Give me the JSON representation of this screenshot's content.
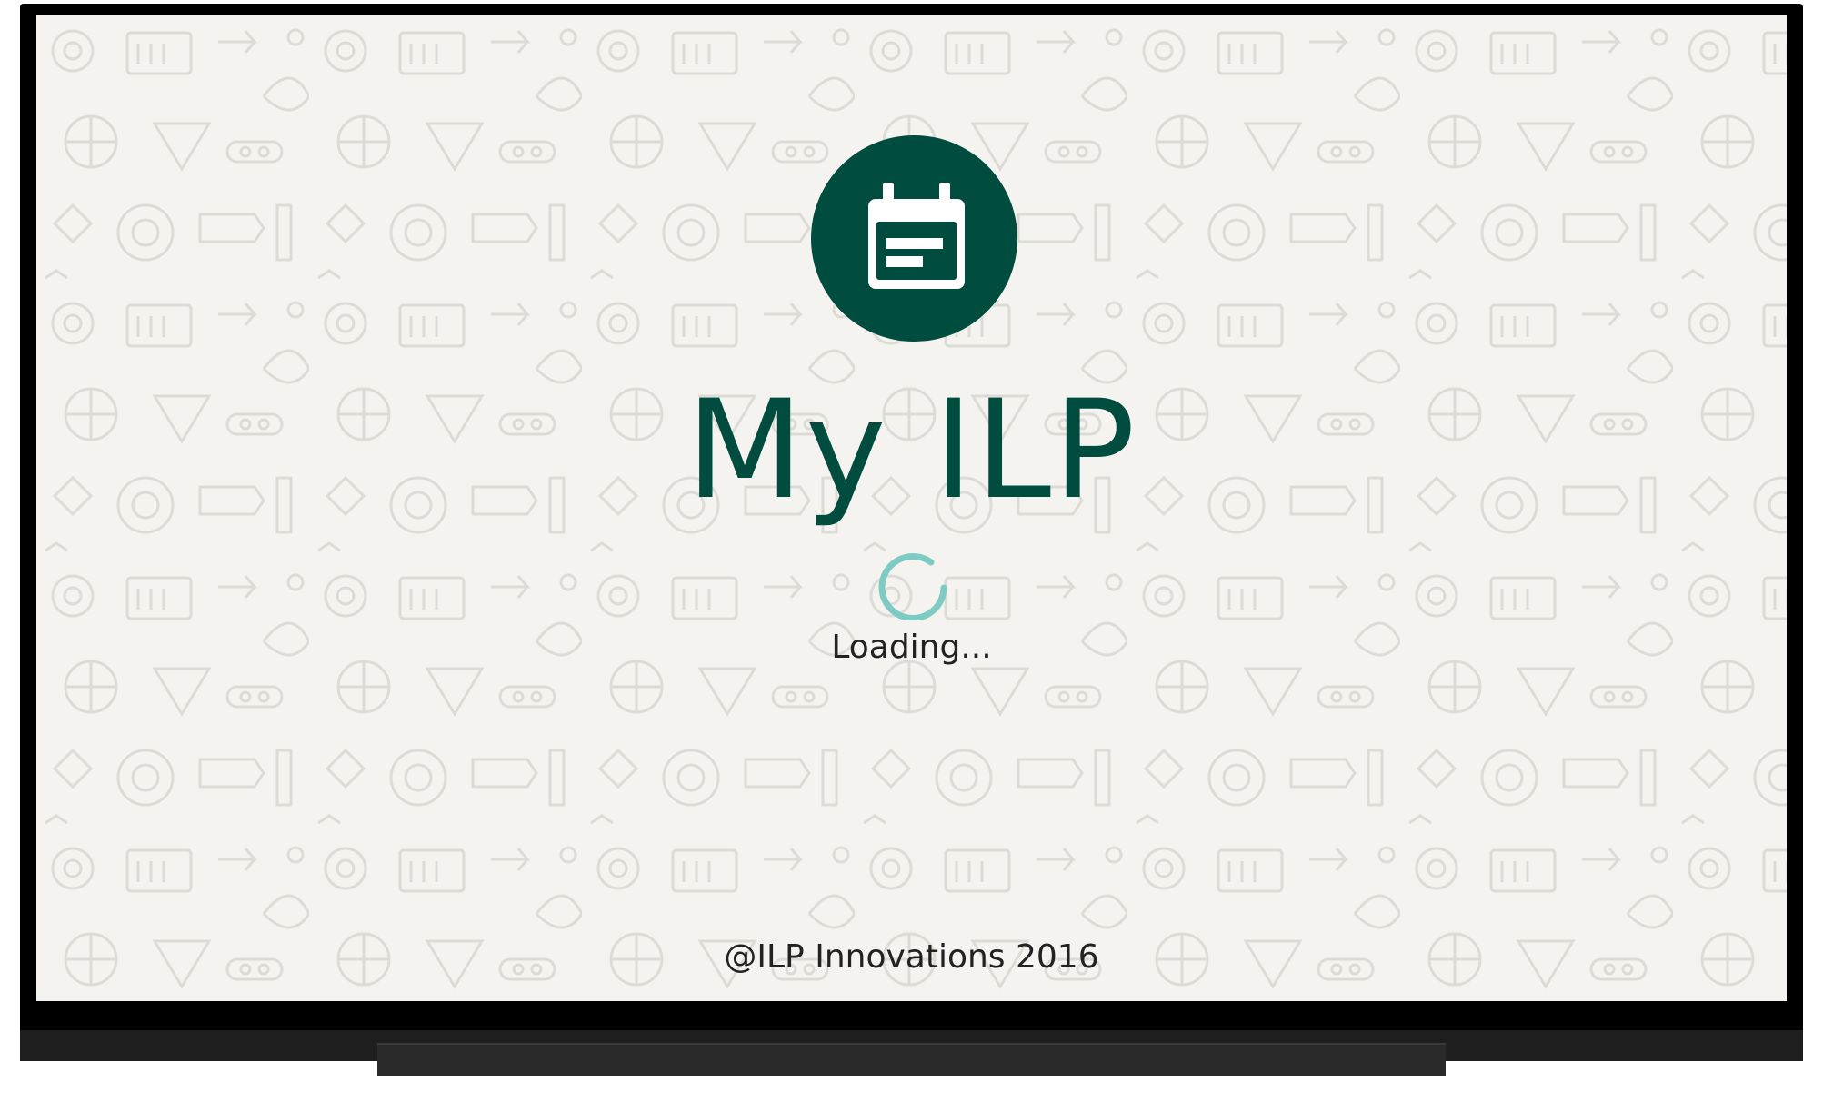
{
  "app": {
    "title": "My ILP",
    "loading_text": "Loading...",
    "footer": "@ILP Innovations 2016"
  },
  "icons": {
    "logo": "calendar-icon",
    "spinner": "loading-spinner-icon",
    "background": "doodle-pattern"
  },
  "colors": {
    "brand": "#004d3f",
    "spinner": "#7ecbc4",
    "screen_background": "#f4f3ef",
    "pattern": "#d9d8d3",
    "text": "#222222",
    "device_frame": "#000000"
  }
}
